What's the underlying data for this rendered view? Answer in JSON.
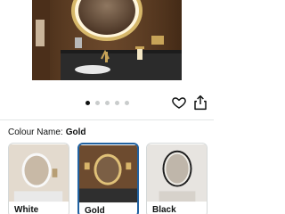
{
  "product_image": {
    "description_icon": "bathroom-mirror-photo"
  },
  "carousel": {
    "total_dots": 5,
    "active_index": 0
  },
  "actions": {
    "favorite_icon": "heart-icon",
    "share_icon": "share-icon"
  },
  "variant": {
    "label": "Colour Name:",
    "selected_value": "Gold",
    "options": [
      {
        "label": "White"
      },
      {
        "label": "Gold"
      },
      {
        "label": "Black"
      }
    ]
  },
  "colors": {
    "selected_border": "#2162a1",
    "text": "#0f1111",
    "divider": "#e3e6e6"
  }
}
